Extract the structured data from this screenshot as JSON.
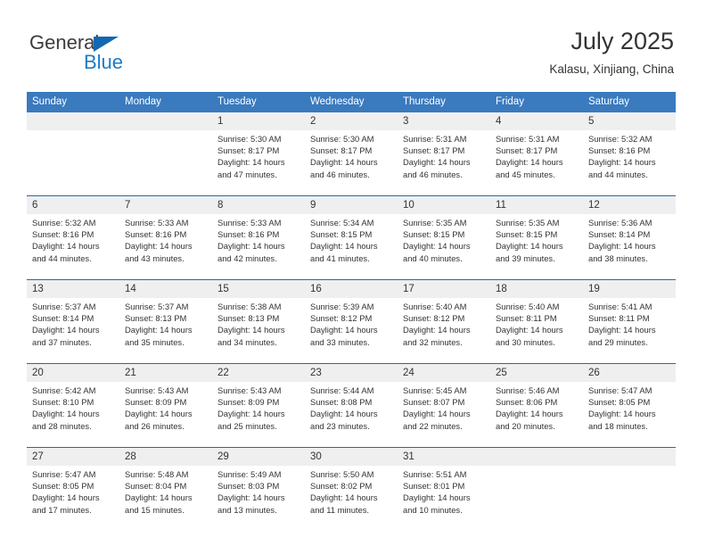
{
  "brand": {
    "name_top": "General",
    "name_bottom": "Blue",
    "triangle_color": "#1268b3",
    "blue_color": "#1f7ac4"
  },
  "header": {
    "title": "July 2025",
    "subtitle": "Kalasu, Xinjiang, China"
  },
  "theme": {
    "header_blue": "#3a7abe",
    "separator_blue": "#2a66ad",
    "daynum_band": "#efefef",
    "text": "#333333"
  },
  "weekday_headers": [
    "Sunday",
    "Monday",
    "Tuesday",
    "Wednesday",
    "Thursday",
    "Friday",
    "Saturday"
  ],
  "weeks": [
    [
      {
        "day": "",
        "lines": []
      },
      {
        "day": "",
        "lines": []
      },
      {
        "day": "1",
        "lines": [
          "Sunrise: 5:30 AM",
          "Sunset: 8:17 PM",
          "Daylight: 14 hours",
          "and 47 minutes."
        ]
      },
      {
        "day": "2",
        "lines": [
          "Sunrise: 5:30 AM",
          "Sunset: 8:17 PM",
          "Daylight: 14 hours",
          "and 46 minutes."
        ]
      },
      {
        "day": "3",
        "lines": [
          "Sunrise: 5:31 AM",
          "Sunset: 8:17 PM",
          "Daylight: 14 hours",
          "and 46 minutes."
        ]
      },
      {
        "day": "4",
        "lines": [
          "Sunrise: 5:31 AM",
          "Sunset: 8:17 PM",
          "Daylight: 14 hours",
          "and 45 minutes."
        ]
      },
      {
        "day": "5",
        "lines": [
          "Sunrise: 5:32 AM",
          "Sunset: 8:16 PM",
          "Daylight: 14 hours",
          "and 44 minutes."
        ]
      }
    ],
    [
      {
        "day": "6",
        "lines": [
          "Sunrise: 5:32 AM",
          "Sunset: 8:16 PM",
          "Daylight: 14 hours",
          "and 44 minutes."
        ]
      },
      {
        "day": "7",
        "lines": [
          "Sunrise: 5:33 AM",
          "Sunset: 8:16 PM",
          "Daylight: 14 hours",
          "and 43 minutes."
        ]
      },
      {
        "day": "8",
        "lines": [
          "Sunrise: 5:33 AM",
          "Sunset: 8:16 PM",
          "Daylight: 14 hours",
          "and 42 minutes."
        ]
      },
      {
        "day": "9",
        "lines": [
          "Sunrise: 5:34 AM",
          "Sunset: 8:15 PM",
          "Daylight: 14 hours",
          "and 41 minutes."
        ]
      },
      {
        "day": "10",
        "lines": [
          "Sunrise: 5:35 AM",
          "Sunset: 8:15 PM",
          "Daylight: 14 hours",
          "and 40 minutes."
        ]
      },
      {
        "day": "11",
        "lines": [
          "Sunrise: 5:35 AM",
          "Sunset: 8:15 PM",
          "Daylight: 14 hours",
          "and 39 minutes."
        ]
      },
      {
        "day": "12",
        "lines": [
          "Sunrise: 5:36 AM",
          "Sunset: 8:14 PM",
          "Daylight: 14 hours",
          "and 38 minutes."
        ]
      }
    ],
    [
      {
        "day": "13",
        "lines": [
          "Sunrise: 5:37 AM",
          "Sunset: 8:14 PM",
          "Daylight: 14 hours",
          "and 37 minutes."
        ]
      },
      {
        "day": "14",
        "lines": [
          "Sunrise: 5:37 AM",
          "Sunset: 8:13 PM",
          "Daylight: 14 hours",
          "and 35 minutes."
        ]
      },
      {
        "day": "15",
        "lines": [
          "Sunrise: 5:38 AM",
          "Sunset: 8:13 PM",
          "Daylight: 14 hours",
          "and 34 minutes."
        ]
      },
      {
        "day": "16",
        "lines": [
          "Sunrise: 5:39 AM",
          "Sunset: 8:12 PM",
          "Daylight: 14 hours",
          "and 33 minutes."
        ]
      },
      {
        "day": "17",
        "lines": [
          "Sunrise: 5:40 AM",
          "Sunset: 8:12 PM",
          "Daylight: 14 hours",
          "and 32 minutes."
        ]
      },
      {
        "day": "18",
        "lines": [
          "Sunrise: 5:40 AM",
          "Sunset: 8:11 PM",
          "Daylight: 14 hours",
          "and 30 minutes."
        ]
      },
      {
        "day": "19",
        "lines": [
          "Sunrise: 5:41 AM",
          "Sunset: 8:11 PM",
          "Daylight: 14 hours",
          "and 29 minutes."
        ]
      }
    ],
    [
      {
        "day": "20",
        "lines": [
          "Sunrise: 5:42 AM",
          "Sunset: 8:10 PM",
          "Daylight: 14 hours",
          "and 28 minutes."
        ]
      },
      {
        "day": "21",
        "lines": [
          "Sunrise: 5:43 AM",
          "Sunset: 8:09 PM",
          "Daylight: 14 hours",
          "and 26 minutes."
        ]
      },
      {
        "day": "22",
        "lines": [
          "Sunrise: 5:43 AM",
          "Sunset: 8:09 PM",
          "Daylight: 14 hours",
          "and 25 minutes."
        ]
      },
      {
        "day": "23",
        "lines": [
          "Sunrise: 5:44 AM",
          "Sunset: 8:08 PM",
          "Daylight: 14 hours",
          "and 23 minutes."
        ]
      },
      {
        "day": "24",
        "lines": [
          "Sunrise: 5:45 AM",
          "Sunset: 8:07 PM",
          "Daylight: 14 hours",
          "and 22 minutes."
        ]
      },
      {
        "day": "25",
        "lines": [
          "Sunrise: 5:46 AM",
          "Sunset: 8:06 PM",
          "Daylight: 14 hours",
          "and 20 minutes."
        ]
      },
      {
        "day": "26",
        "lines": [
          "Sunrise: 5:47 AM",
          "Sunset: 8:05 PM",
          "Daylight: 14 hours",
          "and 18 minutes."
        ]
      }
    ],
    [
      {
        "day": "27",
        "lines": [
          "Sunrise: 5:47 AM",
          "Sunset: 8:05 PM",
          "Daylight: 14 hours",
          "and 17 minutes."
        ]
      },
      {
        "day": "28",
        "lines": [
          "Sunrise: 5:48 AM",
          "Sunset: 8:04 PM",
          "Daylight: 14 hours",
          "and 15 minutes."
        ]
      },
      {
        "day": "29",
        "lines": [
          "Sunrise: 5:49 AM",
          "Sunset: 8:03 PM",
          "Daylight: 14 hours",
          "and 13 minutes."
        ]
      },
      {
        "day": "30",
        "lines": [
          "Sunrise: 5:50 AM",
          "Sunset: 8:02 PM",
          "Daylight: 14 hours",
          "and 11 minutes."
        ]
      },
      {
        "day": "31",
        "lines": [
          "Sunrise: 5:51 AM",
          "Sunset: 8:01 PM",
          "Daylight: 14 hours",
          "and 10 minutes."
        ]
      },
      {
        "day": "",
        "lines": []
      },
      {
        "day": "",
        "lines": []
      }
    ]
  ]
}
